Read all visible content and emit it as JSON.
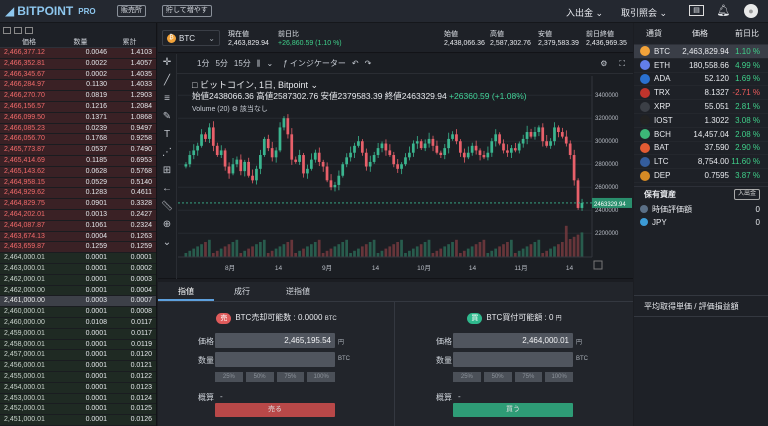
{
  "header": {
    "logo": "BITPOINT",
    "logo_pro": "PRO",
    "btn_exchange": "販売所",
    "btn_save": "貯して増やす",
    "menu_deposit": "入出金",
    "menu_inquiry": "取引照会"
  },
  "orderbook": {
    "headers": [
      "価格",
      "数量",
      "累計"
    ],
    "asks": [
      [
        "2,466,377.12",
        "0.0046",
        "1.4103"
      ],
      [
        "2,466,352.81",
        "0.0022",
        "1.4057"
      ],
      [
        "2,466,345.67",
        "0.0002",
        "1.4035"
      ],
      [
        "2,466,284.97",
        "0.1130",
        "1.4033"
      ],
      [
        "2,466,270.70",
        "0.0819",
        "1.2903"
      ],
      [
        "2,466,156.57",
        "0.1216",
        "1.2084"
      ],
      [
        "2,466,099.50",
        "0.1371",
        "1.0868"
      ],
      [
        "2,466,085.23",
        "0.0239",
        "0.9497"
      ],
      [
        "2,466,056.70",
        "0.1768",
        "0.9258"
      ],
      [
        "2,465,773.87",
        "0.0537",
        "0.7490"
      ],
      [
        "2,465,414.69",
        "0.1185",
        "0.6953"
      ],
      [
        "2,465,143.62",
        "0.0628",
        "0.5768"
      ],
      [
        "2,464,958.15",
        "0.0529",
        "0.5140"
      ],
      [
        "2,464,929.62",
        "0.1283",
        "0.4611"
      ],
      [
        "2,464,829.75",
        "0.0901",
        "0.3328"
      ],
      [
        "2,464,202.01",
        "0.0013",
        "0.2427"
      ],
      [
        "2,464,087.87",
        "0.1061",
        "0.2324"
      ],
      [
        "2,463,674.13",
        "0.0004",
        "0.1263"
      ],
      [
        "2,463,659.87",
        "0.1259",
        "0.1259"
      ]
    ],
    "bids": [
      [
        "2,464,000.01",
        "0.0001",
        "0.0001"
      ],
      [
        "2,463,000.01",
        "0.0001",
        "0.0002"
      ],
      [
        "2,462,000.01",
        "0.0001",
        "0.0003"
      ],
      [
        "2,462,000.00",
        "0.0001",
        "0.0004"
      ],
      [
        "2,461,000.00",
        "0.0003",
        "0.0007"
      ],
      [
        "2,460,000.01",
        "0.0001",
        "0.0008"
      ],
      [
        "2,460,000.00",
        "0.0108",
        "0.0117"
      ],
      [
        "2,459,000.01",
        "0.0001",
        "0.0117"
      ],
      [
        "2,458,000.01",
        "0.0001",
        "0.0119"
      ],
      [
        "2,457,000.01",
        "0.0001",
        "0.0120"
      ],
      [
        "2,456,000.01",
        "0.0001",
        "0.0121"
      ],
      [
        "2,455,000.01",
        "0.0001",
        "0.0122"
      ],
      [
        "2,454,000.01",
        "0.0001",
        "0.0123"
      ],
      [
        "2,453,000.01",
        "0.0001",
        "0.0124"
      ],
      [
        "2,452,000.01",
        "0.0001",
        "0.0125"
      ],
      [
        "2,451,000.01",
        "0.0001",
        "0.0126"
      ],
      [
        "2,450,000.01",
        "0.0001",
        "0.0127"
      ],
      [
        "2,450,000.00",
        "0.0003",
        "0.0131"
      ]
    ],
    "mid_index": 4
  },
  "ticker": {
    "symbol": "BTC",
    "cur_label": "現在値",
    "cur_value": "2,463,829.94",
    "prev_label": "前日比",
    "prev_value": "+26,860.59 (1.10 %)",
    "open_label": "始値",
    "open_value": "2,438,066.36",
    "high_label": "高値",
    "high_value": "2,587,302.76",
    "low_label": "安値",
    "low_value": "2,379,583.39",
    "prevclose_label": "前日終値",
    "prevclose_value": "2,436,969.35"
  },
  "chart_toolbar": {
    "interval_1": "1分",
    "interval_5": "5分",
    "interval_15": "15分",
    "indicator": "インジケーター"
  },
  "chart_legend": {
    "title": "ビットコイン, 1日, Bitpoint",
    "ohlc": "始値2438066.36 高値2587302.76 安値2379583.39 終値2463329.94",
    "change": "+26360.59 (+1.08%)",
    "volume_label": "Volume (20)",
    "volume_value": "該当なし"
  },
  "chart_data": {
    "type": "candlestick",
    "title": "ビットコイン, 1日, Bitpoint",
    "x_ticks": [
      "8月",
      "14",
      "9月",
      "14",
      "10月",
      "14",
      "11月",
      "14"
    ],
    "y_ticks": [
      2200000,
      2400000,
      2600000,
      2800000,
      3000000,
      3200000,
      3400000
    ],
    "ylim": [
      2150000,
      3480000
    ],
    "last_price_label": "2463329.94",
    "last_price": 2463329.94,
    "candles_close": [
      2800000,
      2880000,
      2920000,
      2960000,
      3060000,
      3020000,
      3120000,
      2960000,
      2880000,
      2920000,
      2780000,
      2720000,
      2800000,
      2840000,
      2740000,
      2820000,
      2700000,
      2660000,
      2760000,
      2880000,
      3020000,
      2940000,
      2860000,
      2920000,
      3120000,
      3200000,
      3060000,
      2840000,
      2820000,
      2880000,
      2720000,
      2760000,
      2840000,
      2900000,
      2820000,
      2780000,
      2660000,
      2600000,
      2620000,
      2700000,
      2800000,
      2860000,
      2900000,
      2960000,
      3000000,
      2900000,
      2780000,
      2820000,
      2880000,
      2940000,
      2980000,
      2920000,
      2880000,
      2800000,
      2760000,
      2800000,
      2860000,
      2900000,
      2980000,
      3000000,
      2940000,
      2980000,
      3020000,
      2960000,
      2900000,
      2880000,
      2940000,
      3020000,
      3060000,
      3000000,
      2900000,
      2860000,
      2900000,
      2960000,
      2920000,
      2880000,
      2860000,
      2900000,
      3000000,
      3060000,
      2980000,
      2920000,
      2900000,
      2940000,
      2920000,
      2980000,
      3020000,
      3080000,
      3040000,
      3080000,
      3120000,
      3000000,
      2960000,
      3000000,
      3120000,
      3080000,
      3040000,
      2980000,
      2880000,
      2660000,
      2420000,
      2463329.94
    ],
    "volume_max_ratio": 1.0
  },
  "order_tabs": [
    "指値",
    "成行",
    "逆指値"
  ],
  "sell": {
    "badge": "売",
    "title": "BTC売却可能数 : 0.0000",
    "title_unit": "BTC",
    "price_label": "価格",
    "price_value": "2,465,195.54",
    "price_unit": "円",
    "qty_label": "数量",
    "qty_unit": "BTC",
    "approx_label": "概算",
    "approx_value": "-",
    "action": "売る"
  },
  "buy": {
    "badge": "買",
    "title": "BTC買付可能額 : 0",
    "title_unit": "円",
    "price_label": "価格",
    "price_value": "2,464,000.01",
    "price_unit": "円",
    "qty_label": "数量",
    "qty_unit": "BTC",
    "approx_label": "概算",
    "approx_value": "-",
    "action": "買う"
  },
  "percents": [
    "25%",
    "50%",
    "75%",
    "100%"
  ],
  "currencies": {
    "headers": [
      "通貨",
      "価格",
      "前日比"
    ],
    "rows": [
      {
        "name": "BTC",
        "price": "2,463,829.94",
        "change": "1.10 %",
        "dir": "up",
        "color": "#f2a33a"
      },
      {
        "name": "ETH",
        "price": "180,558.66",
        "change": "4.99 %",
        "dir": "up",
        "color": "#627eea"
      },
      {
        "name": "ADA",
        "price": "52.120",
        "change": "1.69 %",
        "dir": "up",
        "color": "#2a71d0"
      },
      {
        "name": "TRX",
        "price": "8.1327",
        "change": "-2.71 %",
        "dir": "down",
        "color": "#c0342c"
      },
      {
        "name": "XRP",
        "price": "55.051",
        "change": "2.81 %",
        "dir": "up",
        "color": "#3b3f46"
      },
      {
        "name": "IOST",
        "price": "1.3022",
        "change": "3.08 %",
        "dir": "up",
        "color": "#222"
      },
      {
        "name": "BCH",
        "price": "14,457.04",
        "change": "2.08 %",
        "dir": "up",
        "color": "#3cb878"
      },
      {
        "name": "BAT",
        "price": "37.590",
        "change": "2.90 %",
        "dir": "up",
        "color": "#e25b33"
      },
      {
        "name": "LTC",
        "price": "8,754.00",
        "change": "11.60 %",
        "dir": "up",
        "color": "#345d9d"
      },
      {
        "name": "DEP",
        "price": "0.7595",
        "change": "3.87 %",
        "dir": "up",
        "color": "#d58a25"
      }
    ],
    "selected": 0
  },
  "holdings": {
    "title": "保有資産",
    "button": "入出金",
    "rows": [
      {
        "name": "時価評価額",
        "value": "0"
      },
      {
        "name": "JPY",
        "value": "0"
      }
    ]
  },
  "avg_label": "平均取得単価 / 評価損益額"
}
